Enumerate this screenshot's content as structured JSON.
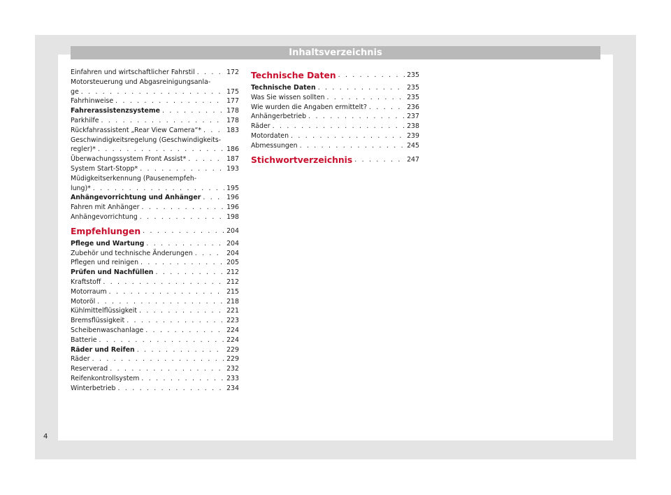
{
  "header": {
    "title": "Inhaltsverzeichnis"
  },
  "left_column": [
    {
      "kind": "plain",
      "title": "Einfahren und wirtschaftlicher Fahrstil",
      "page": "172"
    },
    {
      "kind": "multi",
      "line1": "Motorsteuerung und Abgasreinigungsanla-",
      "line2": "ge",
      "page": "175"
    },
    {
      "kind": "plain",
      "title": "Fahrhinweise",
      "page": "177"
    },
    {
      "kind": "bold",
      "title": "Fahrerassistenzsysteme",
      "page": "178"
    },
    {
      "kind": "plain",
      "title": "Parkhilfe",
      "page": "178"
    },
    {
      "kind": "plain",
      "title": "Rückfahrassistent „Rear View Camera“*",
      "page": "183"
    },
    {
      "kind": "multi",
      "line1": "Geschwindigkeitsregelung (Geschwindigkeits-",
      "line2": "regler)*",
      "page": "186"
    },
    {
      "kind": "plain",
      "title": "Überwachungssystem Front Assist*",
      "page": "187"
    },
    {
      "kind": "plain",
      "title": "System Start-Stopp*",
      "page": "193"
    },
    {
      "kind": "multi",
      "line1": "Müdigkeitserkennung (Pausenempfeh-",
      "line2": "lung)*",
      "page": "195"
    },
    {
      "kind": "bold",
      "title": "Anhängevorrichtung und Anhänger",
      "page": "196"
    },
    {
      "kind": "plain",
      "title": "Fahren mit Anhänger",
      "page": "196"
    },
    {
      "kind": "plain",
      "title": "Anhängevorrichtung",
      "page": "198"
    },
    {
      "kind": "section",
      "title": "Empfehlungen",
      "page": "204"
    },
    {
      "kind": "bold",
      "title": "Pflege und Wartung",
      "page": "204"
    },
    {
      "kind": "plain",
      "title": "Zubehör und technische Änderungen",
      "page": "204"
    },
    {
      "kind": "plain",
      "title": "Pflegen und reinigen",
      "page": "205"
    },
    {
      "kind": "bold",
      "title": "Prüfen und Nachfüllen",
      "page": "212"
    },
    {
      "kind": "plain",
      "title": "Kraftstoff",
      "page": "212"
    },
    {
      "kind": "plain",
      "title": "Motorraum",
      "page": "215"
    },
    {
      "kind": "plain",
      "title": "Motoröl",
      "page": "218"
    },
    {
      "kind": "plain",
      "title": "Kühlmittelflüssigkeit",
      "page": "221"
    },
    {
      "kind": "plain",
      "title": "Bremsflüssigkeit",
      "page": "223"
    },
    {
      "kind": "plain",
      "title": "Scheibenwaschanlage",
      "page": "224"
    },
    {
      "kind": "plain",
      "title": "Batterie",
      "page": "224"
    },
    {
      "kind": "bold",
      "title": "Räder und Reifen",
      "page": "229"
    },
    {
      "kind": "plain",
      "title": "Räder",
      "page": "229"
    },
    {
      "kind": "plain",
      "title": "Reserverad",
      "page": "232"
    },
    {
      "kind": "plain",
      "title": "Reifenkontrollsystem",
      "page": "233"
    },
    {
      "kind": "plain",
      "title": "Winterbetrieb",
      "page": "234"
    }
  ],
  "right_column": [
    {
      "kind": "section",
      "title": "Technische Daten",
      "page": "235"
    },
    {
      "kind": "bold",
      "title": "Technische Daten",
      "page": "235"
    },
    {
      "kind": "plain",
      "title": "Was Sie wissen sollten",
      "page": "235"
    },
    {
      "kind": "plain",
      "title": "Wie wurden die Angaben ermittelt?",
      "page": "236"
    },
    {
      "kind": "plain",
      "title": "Anhängerbetrieb",
      "page": "237"
    },
    {
      "kind": "plain",
      "title": "Räder",
      "page": "238"
    },
    {
      "kind": "plain",
      "title": "Motordaten",
      "page": "239"
    },
    {
      "kind": "plain",
      "title": "Abmessungen",
      "page": "245"
    },
    {
      "kind": "section",
      "title": "Stichwortverzeichnis",
      "page": "247"
    }
  ],
  "footer": {
    "page_number": "4"
  },
  "colors": {
    "section_red": "#c8102e",
    "header_gray": "#b9b9b9",
    "frame_gray": "#e4e4e4"
  }
}
